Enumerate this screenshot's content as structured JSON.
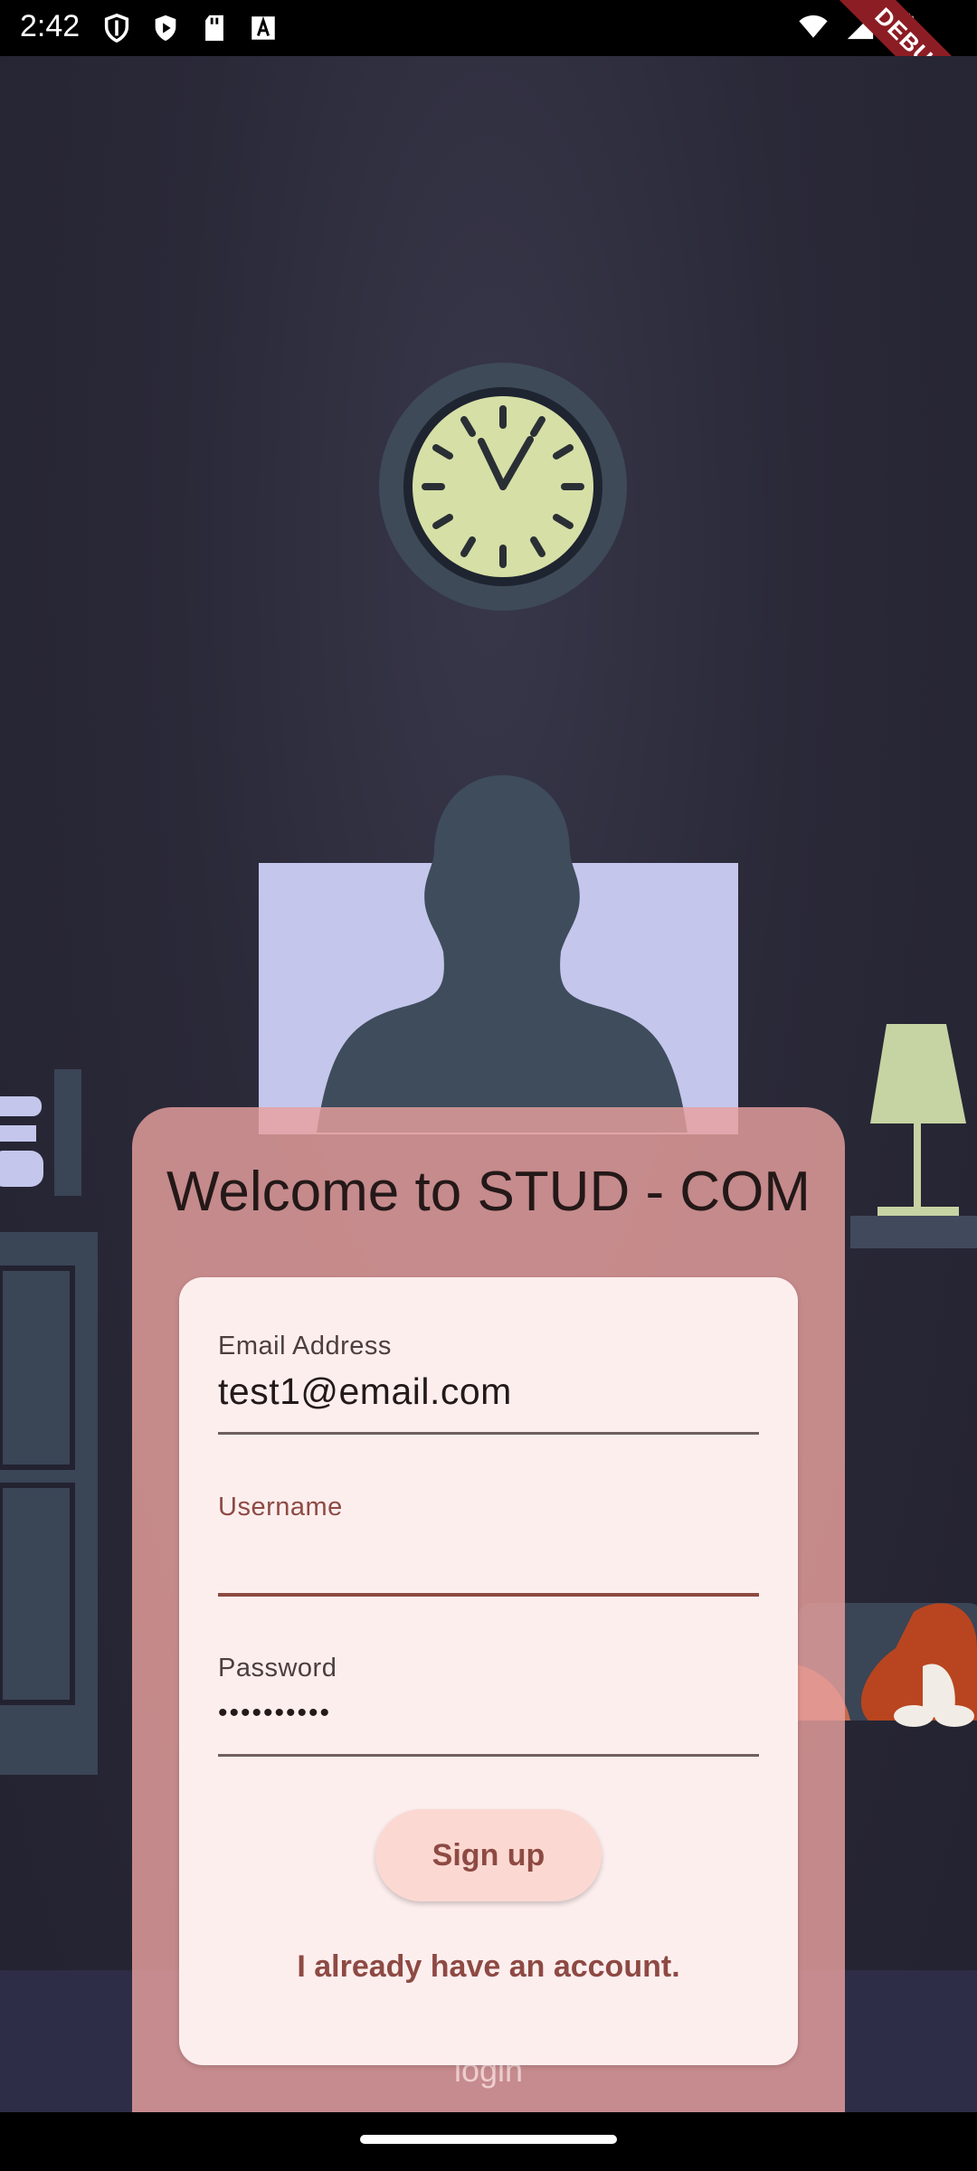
{
  "status_bar": {
    "time": "2:42",
    "left_icons": [
      "shield-icon",
      "play-store-icon",
      "sd-card-icon",
      "a-icon"
    ],
    "right_icons": [
      "wifi-icon",
      "signal-icon",
      "battery-icon"
    ],
    "debug_label": "DEBUG"
  },
  "welcome": {
    "title": "Welcome to STUD - COM",
    "behind_label": "login"
  },
  "form": {
    "email": {
      "label": "Email Address",
      "value": "test1@email.com"
    },
    "username": {
      "label": "Username",
      "value": ""
    },
    "password": {
      "label": "Password",
      "value": "••••••••••"
    },
    "signup_label": "Sign up",
    "login_link": "I already have an account."
  },
  "colors": {
    "accent": "#8d4a43",
    "panel": "#e8a09e",
    "card": "#fdeeee",
    "background": "#2a2938"
  }
}
